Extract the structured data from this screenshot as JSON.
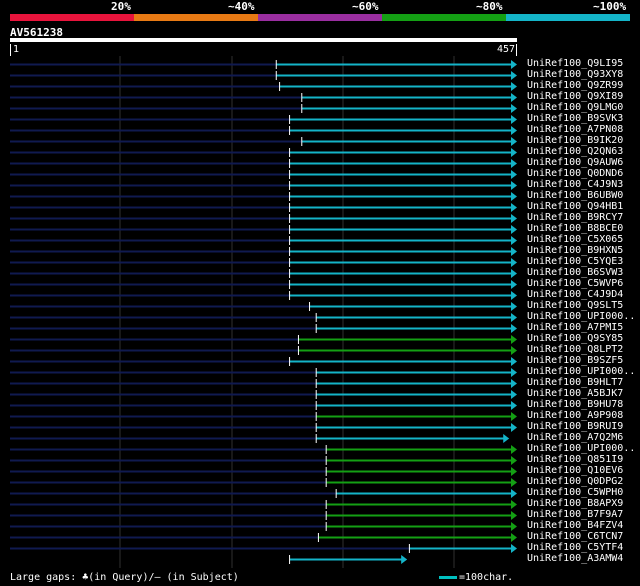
{
  "legend": [
    {
      "label": "20%",
      "color": "#e8143c"
    },
    {
      "label": "~40%",
      "color": "#e87a14"
    },
    {
      "label": "~60%",
      "color": "#9a2ea0"
    },
    {
      "label": "~80%",
      "color": "#14a014"
    },
    {
      "label": "~100%",
      "color": "#14b4c8"
    }
  ],
  "query": {
    "id": "AV561238",
    "start": "1",
    "end": "457",
    "length": 457
  },
  "hits": [
    {
      "name": "UniRef100_Q9LI95",
      "qstart": 240,
      "qend": 457,
      "identity": "~100%",
      "tail_len": 240
    },
    {
      "name": "UniRef100_Q93XY8",
      "qstart": 240,
      "qend": 457,
      "identity": "~100%",
      "tail_len": 240
    },
    {
      "name": "UniRef100_Q9ZR99",
      "qstart": 243,
      "qend": 457,
      "identity": "~100%",
      "tail_len": 243
    },
    {
      "name": "UniRef100_Q9XI89",
      "qstart": 263,
      "qend": 457,
      "identity": "~100%",
      "tail_len": 263
    },
    {
      "name": "UniRef100_Q9LMG0",
      "qstart": 263,
      "qend": 457,
      "identity": "~100%",
      "tail_len": 263
    },
    {
      "name": "UniRef100_B9SVK3",
      "qstart": 252,
      "qend": 457,
      "identity": "~100%",
      "tail_len": 252
    },
    {
      "name": "UniRef100_A7PN08",
      "qstart": 252,
      "qend": 457,
      "identity": "~100%",
      "tail_len": 252
    },
    {
      "name": "UniRef100_B9IK20",
      "qstart": 263,
      "qend": 457,
      "identity": "~100%",
      "tail_len": 263
    },
    {
      "name": "UniRef100_Q2QN63",
      "qstart": 252,
      "qend": 457,
      "identity": "~100%",
      "tail_len": 252
    },
    {
      "name": "UniRef100_Q9AUW6",
      "qstart": 252,
      "qend": 457,
      "identity": "~100%",
      "tail_len": 252
    },
    {
      "name": "UniRef100_Q0DND6",
      "qstart": 252,
      "qend": 457,
      "identity": "~100%",
      "tail_len": 252
    },
    {
      "name": "UniRef100_C4J9N3",
      "qstart": 252,
      "qend": 457,
      "identity": "~100%",
      "tail_len": 252
    },
    {
      "name": "UniRef100_B6UBW0",
      "qstart": 252,
      "qend": 457,
      "identity": "~100%",
      "tail_len": 252
    },
    {
      "name": "UniRef100_Q94HB1",
      "qstart": 252,
      "qend": 457,
      "identity": "~100%",
      "tail_len": 252
    },
    {
      "name": "UniRef100_B9RCY7",
      "qstart": 252,
      "qend": 457,
      "identity": "~100%",
      "tail_len": 252
    },
    {
      "name": "UniRef100_B8BCE0",
      "qstart": 252,
      "qend": 457,
      "identity": "~100%",
      "tail_len": 252
    },
    {
      "name": "UniRef100_C5X065",
      "qstart": 252,
      "qend": 457,
      "identity": "~100%",
      "tail_len": 252
    },
    {
      "name": "UniRef100_B9HXN5",
      "qstart": 252,
      "qend": 457,
      "identity": "~100%",
      "tail_len": 252
    },
    {
      "name": "UniRef100_C5YQE3",
      "qstart": 252,
      "qend": 457,
      "identity": "~100%",
      "tail_len": 252
    },
    {
      "name": "UniRef100_B6SVW3",
      "qstart": 252,
      "qend": 457,
      "identity": "~100%",
      "tail_len": 252
    },
    {
      "name": "UniRef100_C5WVP6",
      "qstart": 252,
      "qend": 457,
      "identity": "~100%",
      "tail_len": 252
    },
    {
      "name": "UniRef100_C4J9D4",
      "qstart": 252,
      "qend": 457,
      "identity": "~100%",
      "tail_len": 252
    },
    {
      "name": "UniRef100_Q9SLT5",
      "qstart": 270,
      "qend": 457,
      "identity": "~100%",
      "tail_len": 270
    },
    {
      "name": "UniRef100_UPI000..",
      "qstart": 276,
      "qend": 457,
      "identity": "~100%",
      "tail_len": 276
    },
    {
      "name": "UniRef100_A7PMI5",
      "qstart": 276,
      "qend": 457,
      "identity": "~100%",
      "tail_len": 276
    },
    {
      "name": "UniRef100_Q9SY85",
      "qstart": 260,
      "qend": 457,
      "identity": "~80%",
      "tail_len": 260
    },
    {
      "name": "UniRef100_Q8LPT2",
      "qstart": 260,
      "qend": 457,
      "identity": "~80%",
      "tail_len": 260
    },
    {
      "name": "UniRef100_B9SZF5",
      "qstart": 252,
      "qend": 457,
      "identity": "~100%",
      "tail_len": 252
    },
    {
      "name": "UniRef100_UPI000..",
      "qstart": 276,
      "qend": 457,
      "identity": "~100%",
      "tail_len": 276
    },
    {
      "name": "UniRef100_B9HLT7",
      "qstart": 276,
      "qend": 457,
      "identity": "~100%",
      "tail_len": 276
    },
    {
      "name": "UniRef100_A5BJK7",
      "qstart": 276,
      "qend": 457,
      "identity": "~100%",
      "tail_len": 276
    },
    {
      "name": "UniRef100_B9HU78",
      "qstart": 276,
      "qend": 457,
      "identity": "~100%",
      "tail_len": 276
    },
    {
      "name": "UniRef100_A9P908",
      "qstart": 276,
      "qend": 457,
      "identity": "~80%",
      "tail_len": 276
    },
    {
      "name": "UniRef100_B9RUI9",
      "qstart": 276,
      "qend": 457,
      "identity": "~100%",
      "tail_len": 276
    },
    {
      "name": "UniRef100_A7Q2M6",
      "qstart": 276,
      "qend": 450,
      "identity": "~100%",
      "tail_len": 276
    },
    {
      "name": "UniRef100_UPI000..",
      "qstart": 285,
      "qend": 457,
      "identity": "~80%",
      "tail_len": 285
    },
    {
      "name": "UniRef100_Q851I9",
      "qstart": 285,
      "qend": 457,
      "identity": "~80%",
      "tail_len": 285
    },
    {
      "name": "UniRef100_Q10EV6",
      "qstart": 285,
      "qend": 457,
      "identity": "~80%",
      "tail_len": 285
    },
    {
      "name": "UniRef100_Q0DPG2",
      "qstart": 285,
      "qend": 457,
      "identity": "~80%",
      "tail_len": 285
    },
    {
      "name": "UniRef100_C5WPH0",
      "qstart": 294,
      "qend": 457,
      "identity": "~100%",
      "tail_len": 294
    },
    {
      "name": "UniRef100_B8APX9",
      "qstart": 285,
      "qend": 457,
      "identity": "~80%",
      "tail_len": 285
    },
    {
      "name": "UniRef100_B7F9A7",
      "qstart": 285,
      "qend": 457,
      "identity": "~80%",
      "tail_len": 285
    },
    {
      "name": "UniRef100_B4FZV4",
      "qstart": 285,
      "qend": 457,
      "identity": "~80%",
      "tail_len": 285
    },
    {
      "name": "UniRef100_C6TCN7",
      "qstart": 278,
      "qend": 457,
      "identity": "~80%",
      "tail_len": 278
    },
    {
      "name": "UniRef100_C5YTF4",
      "qstart": 360,
      "qend": 457,
      "identity": "~100%",
      "tail_len": 360
    },
    {
      "name": "UniRef100_A3AMW4",
      "qstart": 252,
      "qend": 358,
      "identity": "~100%",
      "tail_len": 0
    }
  ],
  "footer": {
    "gaps": "Large gaps: ♣(in Query)/— (in Subject)",
    "scale": "=100char."
  }
}
